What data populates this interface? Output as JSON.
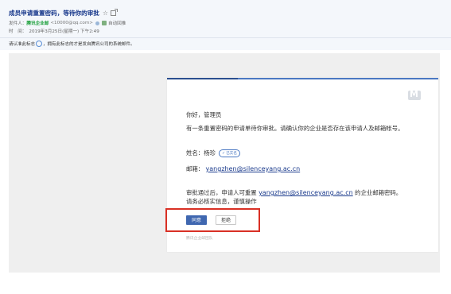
{
  "header": {
    "subject": "成员申请重置密码，等待你的审批",
    "sender_label": "发件人：",
    "sender_name": "腾讯企业邮",
    "sender_address": "<10000@qq.com>",
    "auto_reply_label": "自动回推",
    "time_label": "时　间：",
    "time_value": "2019年3月25日(星期一) 下午2:49"
  },
  "notice": {
    "prefix": "请认准此标志",
    "suffix": "，拥有此标志的才是发自腾讯公司的系统邮件。"
  },
  "email": {
    "greeting": "你好，管理员",
    "intro": "有一条重置密码的申请单待你审批。请确认你的企业是否存在该申请人及邮箱帐号。",
    "name_label": "姓名：",
    "name_value": "杨珍",
    "verified_label": "已实名",
    "email_label": "邮箱：",
    "email_value": "yangzhen@silenceyang.ac.cn",
    "approve_text_before": "审批通过后，申请人可重置",
    "approve_text_email": "yangzhen@silenceyang.ac.cn",
    "approve_text_after": "的企业邮箱密码。",
    "approve_text_line2": "请务必核实信息，谨慎操作",
    "approve_button": "同意",
    "reject_button": "拒绝",
    "footer": "腾讯企业邮团队"
  },
  "colors": {
    "accent": "#3f67b0",
    "subject": "#1a3a8c",
    "sender_green": "#1b9f3a",
    "highlight_red": "#d93025"
  },
  "icons": [
    "star-icon",
    "popout-icon",
    "contact-icon",
    "shield-icon",
    "question-mark-icon",
    "check-icon",
    "tencent-mail-logo-icon"
  ]
}
